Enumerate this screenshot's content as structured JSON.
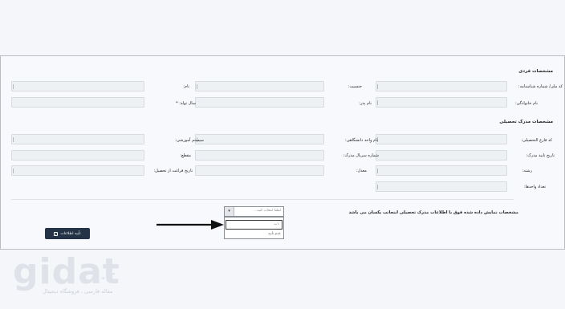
{
  "sections": {
    "personal_title": "مشخصات فردی",
    "education_title": "مشخصات مدرک تحصیلی"
  },
  "personal": {
    "national_code_label": "کد ملی/ شماره شناسنامه:",
    "gender_label": "جنسیت:",
    "name_label": "نام:",
    "last_name_label": "نام خانوادگی:",
    "father_name_label": "نام پدر:",
    "birth_year_label": "سال تولد: *"
  },
  "education": {
    "grad_code_label": "کد فارغ التحصیلی:",
    "university_label": "نام واحد دانشگاهی:",
    "edu_system_label": "سیستم آموزشی:",
    "cert_date_label": "تاریخ تایید مدرک:",
    "cert_serial_label": "شماره سریال مدرک:",
    "degree_label": "مقطع:",
    "major_label": "رشته:",
    "gpa_label": "معدل:",
    "grad_date_label": "تاریخ فراغت از تحصیل:",
    "units_label": "تعداد واحدها:"
  },
  "confirm": {
    "question": "مشخصات نمایش داده شده فوق با اطلاعات مدرک تحصیلی اینجانب یکسان می باشد",
    "select_placeholder": "لطفا انتخاب کنید...",
    "options": [
      "تأیید",
      "عدم تأیید"
    ],
    "button_label": "تأیید اطلاعات"
  },
  "watermark": {
    "logo": "gidat",
    "tld": ".ir",
    "tagline": "مقاله فارسی ، فروشگاه دیجیتال"
  }
}
